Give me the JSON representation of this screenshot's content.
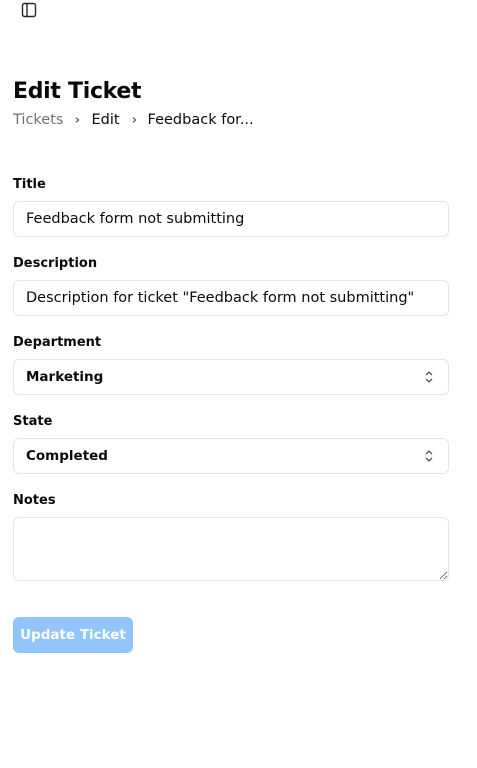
{
  "toolbar": {
    "sidebar_toggle_icon": "panel-left-icon"
  },
  "header": {
    "title": "Edit Ticket",
    "breadcrumb": [
      {
        "label": "Tickets"
      },
      {
        "label": "Edit"
      },
      {
        "label": "Feedback for..."
      }
    ]
  },
  "form": {
    "title": {
      "label": "Title",
      "value": "Feedback form not submitting"
    },
    "description": {
      "label": "Description",
      "value": "Description for ticket \"Feedback form not submitting\""
    },
    "department": {
      "label": "Department",
      "value": "Marketing"
    },
    "state": {
      "label": "State",
      "value": "Completed"
    },
    "notes": {
      "label": "Notes",
      "value": ""
    },
    "submit_label": "Update Ticket"
  },
  "colors": {
    "primary_disabled": "#93c5fd",
    "border": "#e4e4e7",
    "muted_text": "#71717a"
  }
}
